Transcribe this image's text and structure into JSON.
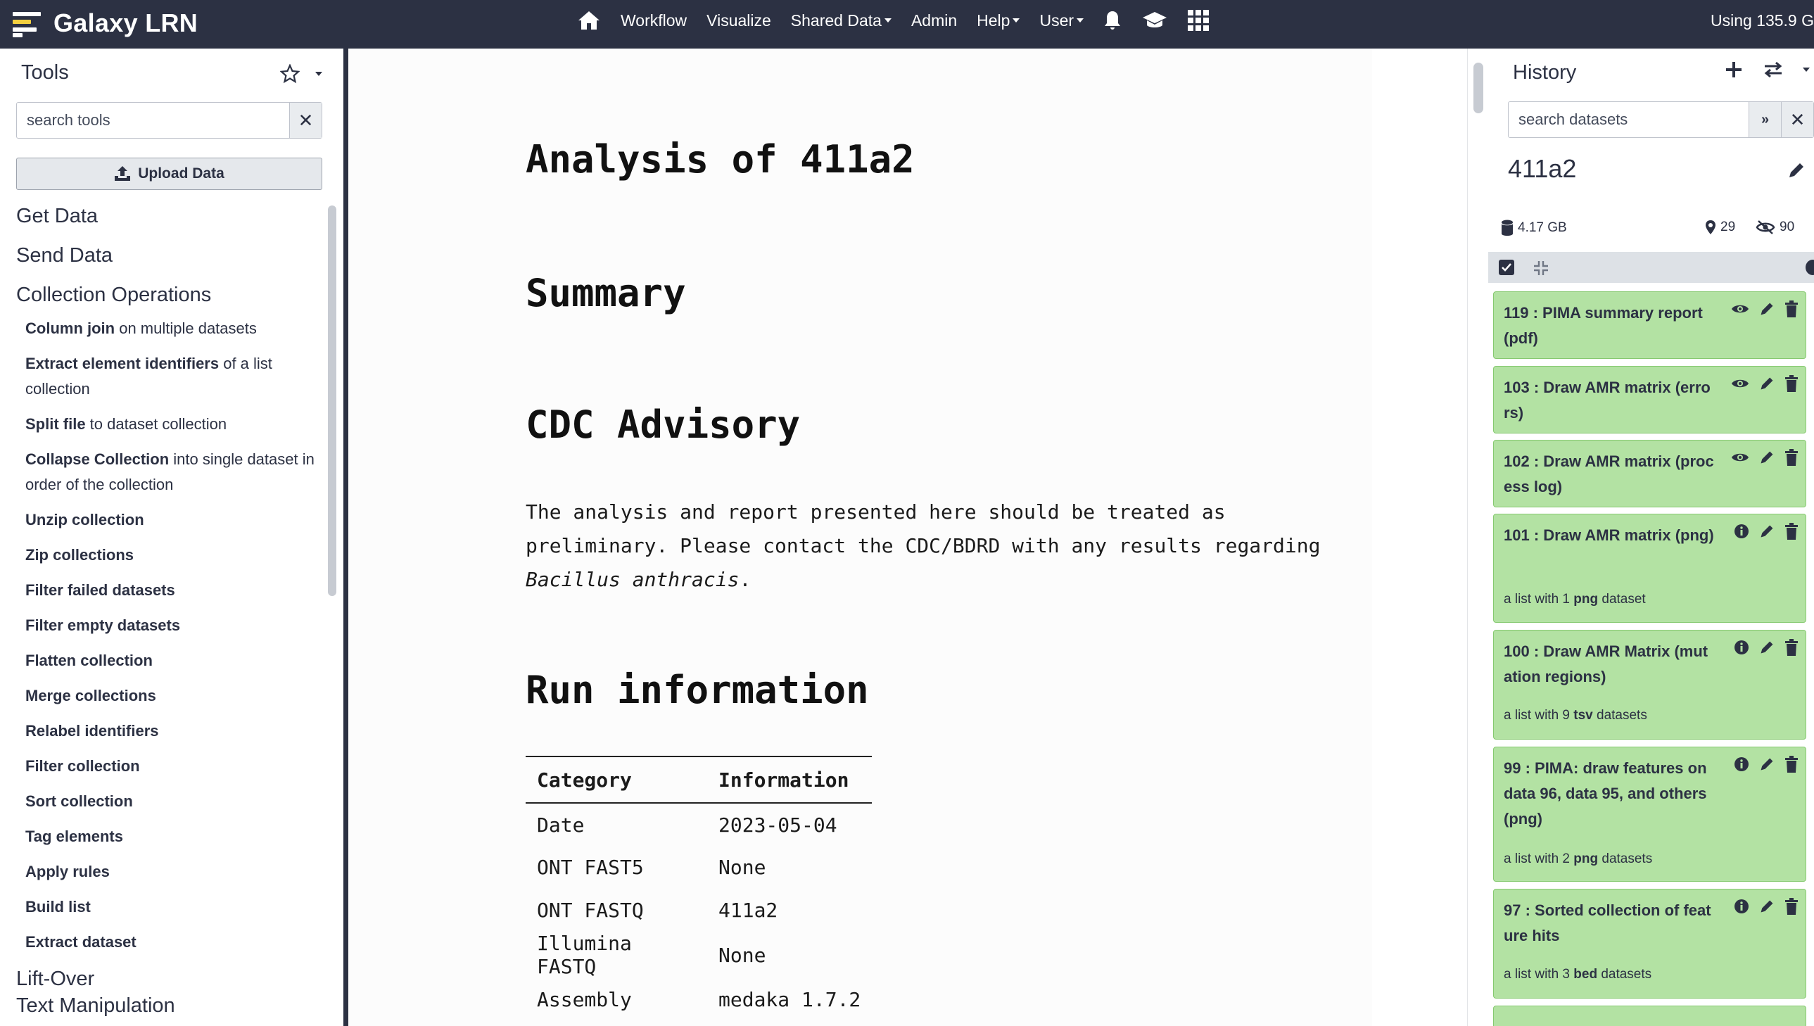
{
  "masthead": {
    "brand": "Galaxy LRN",
    "nav": [
      {
        "label": "Workflow",
        "dropdown": false
      },
      {
        "label": "Visualize",
        "dropdown": false
      },
      {
        "label": "Shared Data",
        "dropdown": true
      },
      {
        "label": "Admin",
        "dropdown": false
      },
      {
        "label": "Help",
        "dropdown": true
      },
      {
        "label": "User",
        "dropdown": true
      }
    ],
    "quota": "Using 135.9 G"
  },
  "tools": {
    "title": "Tools",
    "search_placeholder": "search tools",
    "upload_label": "Upload Data",
    "sections": [
      "Get Data",
      "Send Data",
      "Collection Operations",
      "Lift-Over",
      "Text Manipulation"
    ],
    "items": [
      {
        "name": "Column join",
        "desc": " on multiple datasets"
      },
      {
        "name": "Extract element identifiers",
        "desc": " of a list collection"
      },
      {
        "name": "Split file",
        "desc": " to dataset collection"
      },
      {
        "name": "Collapse Collection",
        "desc": " into single dataset in order of the collection"
      },
      {
        "name": "Unzip collection",
        "desc": ""
      },
      {
        "name": "Zip collections",
        "desc": ""
      },
      {
        "name": "Filter failed datasets",
        "desc": ""
      },
      {
        "name": "Filter empty datasets",
        "desc": ""
      },
      {
        "name": "Flatten collection",
        "desc": ""
      },
      {
        "name": "Merge collections",
        "desc": ""
      },
      {
        "name": "Relabel identifiers",
        "desc": ""
      },
      {
        "name": "Filter collection",
        "desc": ""
      },
      {
        "name": "Sort collection",
        "desc": ""
      },
      {
        "name": "Tag elements",
        "desc": ""
      },
      {
        "name": "Apply rules",
        "desc": ""
      },
      {
        "name": "Build list",
        "desc": ""
      },
      {
        "name": "Extract dataset",
        "desc": ""
      }
    ]
  },
  "report": {
    "title": "Analysis of 411a2",
    "h_summary": "Summary",
    "h_advisory": "CDC Advisory",
    "advisory_text": "The analysis and report presented here should be treated as preliminary. Please contact the CDC/BDRD with any results regarding ",
    "advisory_species": "Bacillus anthracis",
    "advisory_end": ".",
    "h_run": "Run information",
    "table_headers": [
      "Category",
      "Information"
    ],
    "table_rows": [
      [
        "Date",
        "2023-05-04"
      ],
      [
        "ONT FAST5",
        "None"
      ],
      [
        "ONT FASTQ",
        "411a2"
      ],
      [
        "Illumina FASTQ",
        "None"
      ],
      [
        "Assembly",
        "medaka 1.7.2"
      ]
    ]
  },
  "history": {
    "title": "History",
    "search_placeholder": "search datasets",
    "name": "411a2",
    "size": "4.17 GB",
    "shown": "29",
    "hidden": "90",
    "items": [
      {
        "title": "119 : PIMA summary report (pdf)",
        "icon": "eye"
      },
      {
        "title": "103 : Draw AMR matrix (errors)",
        "icon": "eye"
      },
      {
        "title": "102 : Draw AMR matrix (process log)",
        "icon": "eye"
      },
      {
        "title": "101 : Draw AMR matrix (png)",
        "icon": "info",
        "sub_pre": "a list with 1 ",
        "sub_fmt": "png",
        "sub_post": " dataset"
      },
      {
        "title": "100 : Draw AMR Matrix (mutation regions)",
        "icon": "info",
        "sub_pre": "a list with 9 ",
        "sub_fmt": "tsv",
        "sub_post": " datasets"
      },
      {
        "title": "99 : PIMA: draw features on data 96, data 95, and others (png)",
        "icon": "info",
        "sub_pre": "a list with 2 ",
        "sub_fmt": "png",
        "sub_post": " datasets"
      },
      {
        "title": "97 : Sorted collection of feature hits",
        "icon": "info",
        "sub_pre": "a list with 3 ",
        "sub_fmt": "bed",
        "sub_post": " datasets"
      }
    ]
  }
}
